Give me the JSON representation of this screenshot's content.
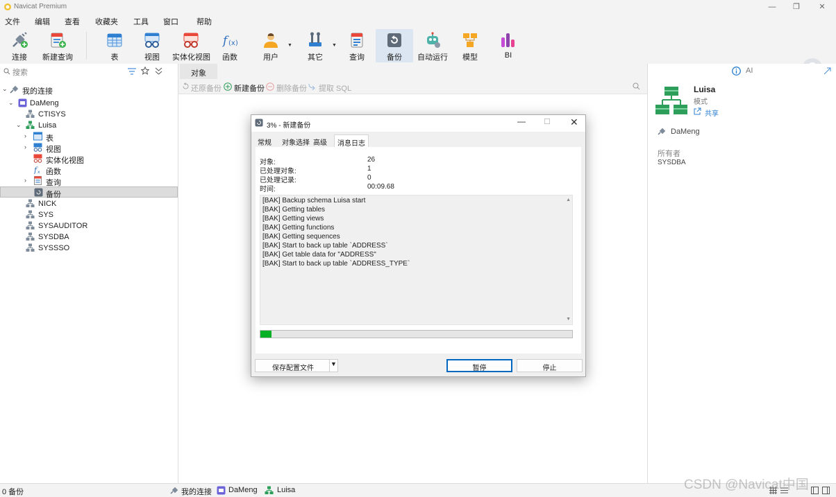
{
  "app": {
    "title": "Navicat Premium"
  },
  "menu": [
    "文件",
    "编辑",
    "查看",
    "收藏夹",
    "工具",
    "窗口",
    "帮助"
  ],
  "toolbar": {
    "connect": "连接",
    "new_query": "新建查询",
    "table": "表",
    "view": "视图",
    "materialized_view": "实体化视图",
    "function": "函数",
    "user": "用户",
    "other": "其它",
    "query": "查询",
    "backup": "备份",
    "automation": "自动运行",
    "model": "模型",
    "bi": "BI"
  },
  "left": {
    "search_placeholder": "搜索",
    "tree": {
      "my_connections": "我的连接",
      "dameng": "DaMeng",
      "ctisys": "CTISYS",
      "luisa": "Luisa",
      "tables": "表",
      "views": "视图",
      "mviews": "实体化视图",
      "functions": "函数",
      "queries": "查询",
      "backups": "备份",
      "nick": "NICK",
      "sys": "SYS",
      "sysauditor": "SYSAUDITOR",
      "sysdba": "SYSDBA",
      "syssso": "SYSSSO"
    }
  },
  "center": {
    "tab": "对象",
    "actions": {
      "restore": "还原备份",
      "new": "新建备份",
      "delete": "删除备份",
      "extract": "提取 SQL"
    }
  },
  "right": {
    "ai": "AI",
    "name": "Luisa",
    "type": "模式",
    "share": "共享",
    "connection": "DaMeng",
    "owner_label": "所有者",
    "owner": "SYSDBA"
  },
  "dialog": {
    "title": "3% - 新建备份",
    "tabs": [
      "常规",
      "对象选择",
      "高级",
      "消息日志"
    ],
    "stats": {
      "objects_label": "对象:",
      "objects_value": "26",
      "processed_objects_label": "已处理对象:",
      "processed_objects_value": "1",
      "processed_records_label": "已处理记录:",
      "processed_records_value": "0",
      "time_label": "时间:",
      "time_value": "00:09.68"
    },
    "log": [
      "[BAK] Backup schema Luisa start",
      "[BAK] Getting tables",
      "[BAK] Getting views",
      "[BAK] Getting functions",
      "[BAK] Getting sequences",
      "[BAK] Start to back up table `ADDRESS`",
      "[BAK] Get table data for \"ADDRESS\"",
      "[BAK] Start to back up table `ADDRESS_TYPE`"
    ],
    "progress_fraction": 0.03,
    "buttons": {
      "save_profile": "保存配置文件",
      "pause": "暂停",
      "stop": "停止"
    }
  },
  "status": {
    "left": "0 备份",
    "conn": "我的连接",
    "db": "DaMeng",
    "schema": "Luisa"
  },
  "watermark": "CSDN @Navicat中国",
  "colors": {
    "accent": "#0067c0",
    "progress": "#06b025",
    "selected_bg": "#dcdcdc",
    "active_tool": "#dbe6f2"
  }
}
